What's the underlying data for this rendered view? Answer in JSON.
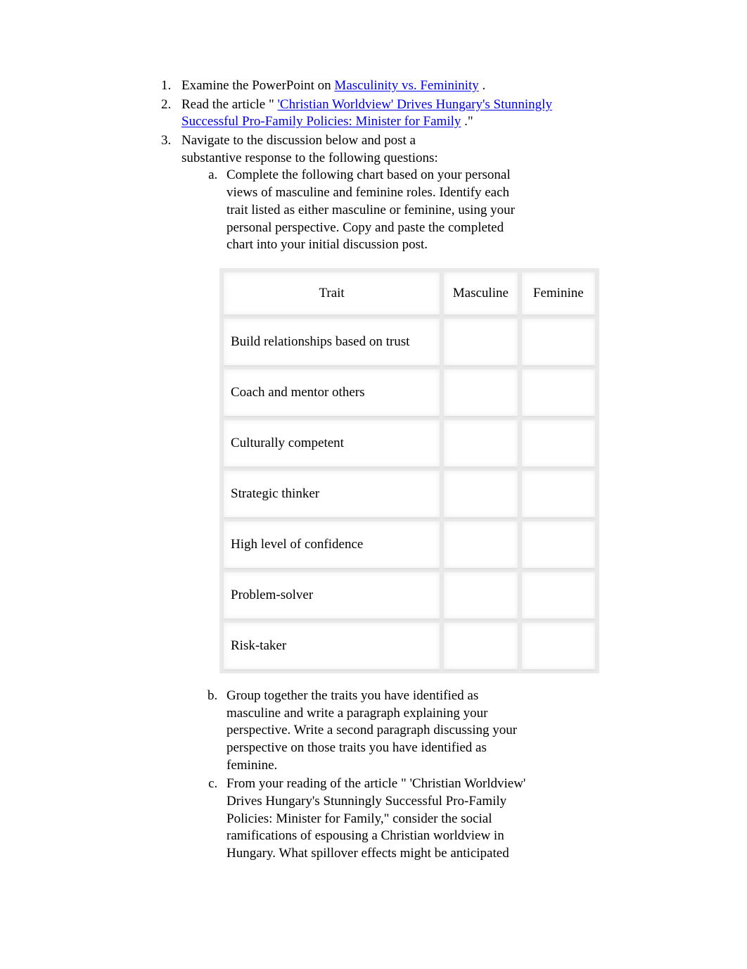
{
  "item1": {
    "prefix": "Examine the PowerPoint on ",
    "link": "Masculinity vs. Femininity",
    "suffix": "."
  },
  "item2": {
    "prefix": "Read the article \"",
    "link": "'Christian Worldview' Drives Hungary's Stunningly Successful Pro-Family Policies: Minister for Family",
    "suffix": ".\""
  },
  "item3": {
    "intro1": "Navigate to the discussion below and post a",
    "intro2": "substantive response to the following questions:",
    "a": "Complete the following chart based on your personal views of masculine and feminine roles. Identify each trait listed as either masculine or feminine, using your personal perspective. Copy and paste the completed chart into your initial discussion post.",
    "b": "Group together the traits you have identified as masculine and write a paragraph explaining your perspective. Write a second paragraph discussing your perspective on those traits you have identified as feminine.",
    "c": "From your reading of the article \" 'Christian Worldview' Drives Hungary's Stunningly Successful Pro-Family Policies: Minister for Family,\" consider the social ramifications of espousing a Christian worldview in Hungary. What spillover effects might be anticipated"
  },
  "table": {
    "headers": {
      "trait": "Trait",
      "masculine": "Masculine",
      "feminine": "Feminine"
    },
    "rows": [
      {
        "trait": "Build relationships based on trust",
        "m": "",
        "f": ""
      },
      {
        "trait": "Coach and mentor others",
        "m": "",
        "f": ""
      },
      {
        "trait": "Culturally competent",
        "m": "",
        "f": ""
      },
      {
        "trait": "Strategic thinker",
        "m": "",
        "f": ""
      },
      {
        "trait": "High level of confidence",
        "m": "",
        "f": ""
      },
      {
        "trait": "Problem-solver",
        "m": "",
        "f": ""
      },
      {
        "trait": "Risk-taker",
        "m": "",
        "f": ""
      }
    ]
  }
}
